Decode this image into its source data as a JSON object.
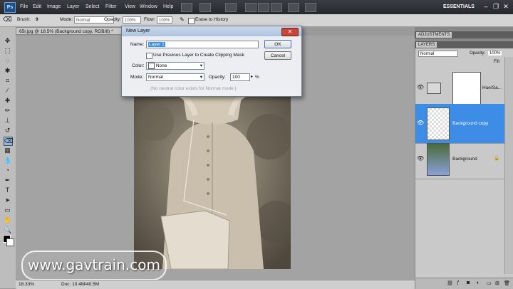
{
  "menu": {
    "logo": "Ps",
    "items": [
      "File",
      "Edit",
      "Image",
      "Layer",
      "Select",
      "Filter",
      "View",
      "Window",
      "Help"
    ],
    "workspace": "ESSENTIALS"
  },
  "options": {
    "brush_label": "Brush:",
    "brush_size": "9",
    "mode_label": "Mode:",
    "mode_value": "Normal",
    "opacity_label": "Opacity:",
    "opacity_value": "100%",
    "flow_label": "Flow:",
    "flow_value": "100%",
    "erase_history": "Erase to History"
  },
  "document": {
    "tab": "65r.jpg @ 18.5% (Background copy, RGB/8) *",
    "zoom": "18.33%",
    "doc_info": "Doc: 10.4M/40.5M"
  },
  "dialog": {
    "title": "New Layer",
    "name_label": "Name:",
    "name_value": "Layer 1",
    "clipping_label": "Use Previous Layer to Create Clipping Mask",
    "color_label": "Color:",
    "color_value": "None",
    "mode_label": "Mode:",
    "mode_value": "Normal",
    "opacity_label": "Opacity:",
    "opacity_value": "100",
    "opacity_unit": "%",
    "note": "(No neutral color exists for Normal mode.)",
    "ok": "OK",
    "cancel": "Cancel",
    "close": "✕"
  },
  "panels": {
    "adjustments_tab": "ADJUSTMENTS",
    "layers_tab": "LAYERS",
    "blend_mode": "Normal",
    "opacity_label": "Opacity:",
    "opacity_value": "100%",
    "fill_label": "Fill:",
    "layers": [
      {
        "name": "Hue/Sa...",
        "selected": false
      },
      {
        "name": "Background copy",
        "selected": true
      },
      {
        "name": "Background",
        "selected": false
      }
    ]
  },
  "watermark": "www.gavtrain.com",
  "colors": {
    "selection": "#3d8de6",
    "menubar": "#2c2f33",
    "panel": "#c9c9c9"
  }
}
